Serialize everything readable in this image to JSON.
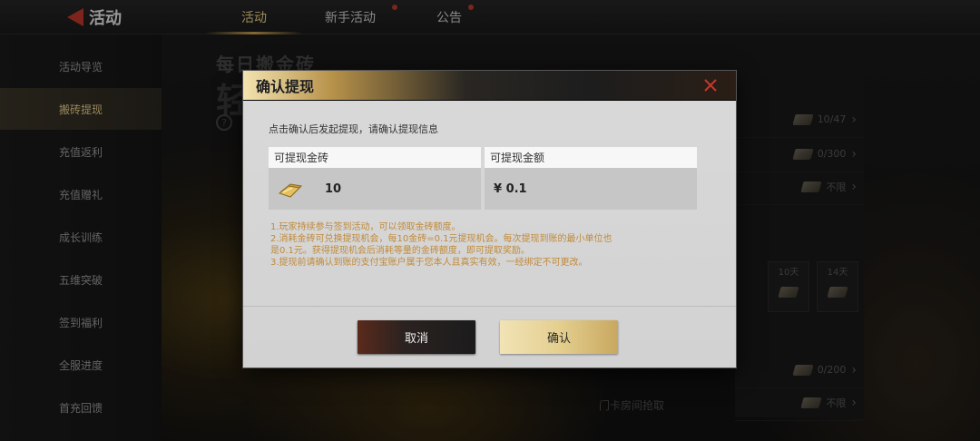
{
  "topbar": {
    "back_label": "活动",
    "tabs": [
      {
        "label": "活动",
        "active": true
      },
      {
        "label": "新手活动",
        "active": false
      },
      {
        "label": "公告",
        "active": false
      }
    ]
  },
  "sidebar": {
    "items": [
      {
        "label": "活动导览",
        "active": false
      },
      {
        "label": "搬砖提现",
        "active": true
      },
      {
        "label": "充值返利",
        "active": false
      },
      {
        "label": "充值赠礼",
        "active": false
      },
      {
        "label": "成长训练",
        "active": false
      },
      {
        "label": "五维突破",
        "active": false
      },
      {
        "label": "签到福利",
        "active": false
      },
      {
        "label": "全服进度",
        "active": false
      },
      {
        "label": "首充回馈",
        "active": false
      }
    ]
  },
  "content": {
    "header": "每日搬金砖",
    "big_char": "轻"
  },
  "right_panel": {
    "rows": [
      "10/47",
      "0/300",
      "不限",
      "0/200",
      "不限"
    ],
    "day_cards": [
      "10天",
      "14天"
    ],
    "bottom_text": "门卡房间抢取"
  },
  "modal": {
    "title": "确认提现",
    "hint": "点击确认后发起提现，请确认提现信息",
    "table": {
      "col1_header": "可提现金砖",
      "col1_value": "10",
      "col2_header": "可提现金额",
      "col2_value": "¥ 0.1"
    },
    "rules": [
      "1.玩家持续参与签到活动，可以领取金砖额度。",
      "2.消耗金砖可兑换提现机会，每10金砖=0.1元提现机会。每次提现到账的最小单位也",
      "是0.1元。获得提现机会后消耗等量的金砖额度，即可提取奖励。",
      "3.提现前请确认到账的支付宝账户属于您本人且真实有效，一经绑定不可更改。"
    ],
    "cancel_label": "取消",
    "confirm_label": "确认"
  },
  "colors": {
    "accent_gold": "#e4cf8f",
    "rules_text": "#c08a3a",
    "close_red": "#c0392b"
  }
}
